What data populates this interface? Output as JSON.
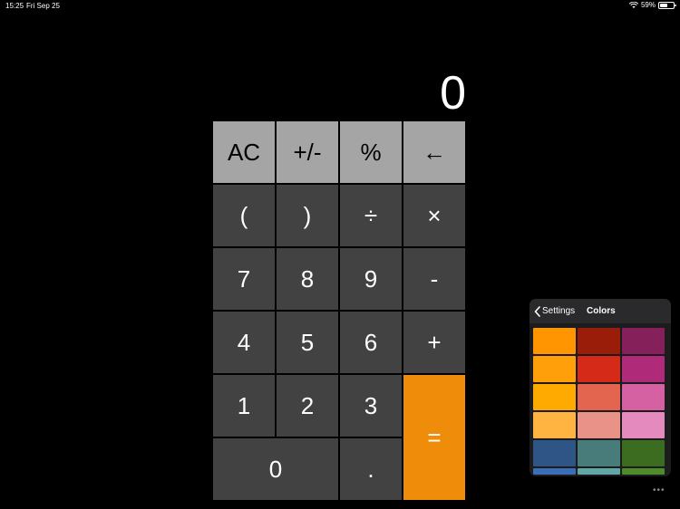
{
  "status": {
    "time": "15:25",
    "date": "Fri Sep 25",
    "battery": "59%",
    "battery_level": 0.59,
    "wifi_icon": "wifi-icon"
  },
  "display": {
    "value": "0"
  },
  "keys": {
    "ac": "AC",
    "sign": "+/-",
    "percent": "%",
    "backspace": "←",
    "open_paren": "(",
    "close_paren": ")",
    "divide": "÷",
    "multiply": "×",
    "seven": "7",
    "eight": "8",
    "nine": "9",
    "minus": "-",
    "four": "4",
    "five": "5",
    "six": "6",
    "plus": "+",
    "one": "1",
    "two": "2",
    "three": "3",
    "equals": "=",
    "zero": "0",
    "decimal": "."
  },
  "colors_panel": {
    "back_label": "Settings",
    "back_icon": "chevron-left-icon",
    "title": "Colors",
    "swatches": [
      "#ff9500",
      "#9a1d0a",
      "#86205a",
      "#ff9f0a",
      "#d42a17",
      "#af2a78",
      "#ffaa00",
      "#e3654f",
      "#d561a3",
      "#ffb340",
      "#e99288",
      "#e58abe",
      "#2f5587",
      "#477c7a",
      "#3b6c1f",
      "#3a6fb8",
      "#5fa8a5",
      "#4e8c2a"
    ]
  },
  "more_menu": {
    "label": "•••"
  },
  "colors": {
    "key_dark": "#424242",
    "key_light": "#a5a5a5",
    "key_accent": "#ef8d0b"
  }
}
